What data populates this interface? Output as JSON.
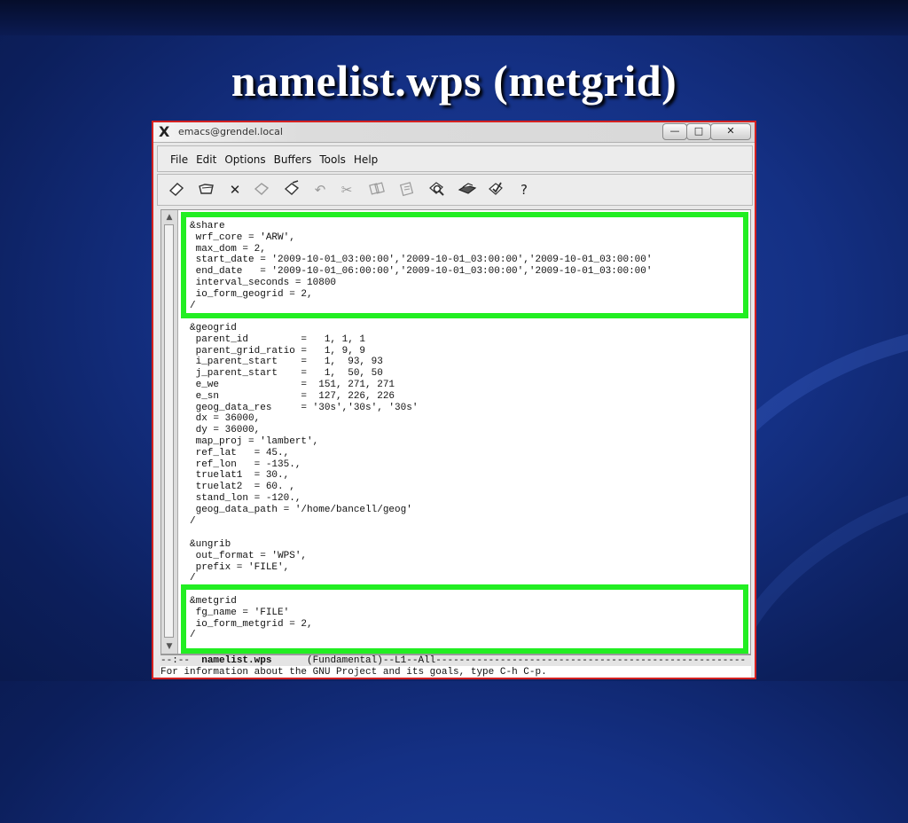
{
  "slide": {
    "title": "namelist.wps (metgrid)"
  },
  "window": {
    "title": "emacs@grendel.local",
    "controls": {
      "minimize": "—",
      "maximize": "□",
      "close": "✕"
    }
  },
  "menu": [
    "File",
    "Edit",
    "Options",
    "Buffers",
    "Tools",
    "Help"
  ],
  "toolbar_icons": [
    "new-file-icon",
    "open-folder-icon",
    "close-icon",
    "save-icon",
    "save-as-icon",
    "undo-icon",
    "cut-icon",
    "copy-icon",
    "paste-icon",
    "search-icon",
    "print-icon",
    "spell-check-icon",
    "help-icon"
  ],
  "code": {
    "share": "&share\n wrf_core = 'ARW',\n max_dom = 2,\n start_date = '2009-10-01_03:00:00','2009-10-01_03:00:00','2009-10-01_03:00:00'\n end_date   = '2009-10-01_06:00:00','2009-10-01_03:00:00','2009-10-01_03:00:00'\n interval_seconds = 10800\n io_form_geogrid = 2,\n/",
    "geogrid": "&geogrid\n parent_id         =   1, 1, 1\n parent_grid_ratio =   1, 9, 9\n i_parent_start    =   1,  93, 93\n j_parent_start    =   1,  50, 50\n e_we              =  151, 271, 271\n e_sn              =  127, 226, 226\n geog_data_res     = '30s','30s', '30s'\n dx = 36000,\n dy = 36000,\n map_proj = 'lambert',\n ref_lat   = 45.,\n ref_lon   = -135.,\n truelat1  = 30.,\n truelat2  = 60. ,\n stand_lon = -120.,\n geog_data_path = '/home/bancell/geog'\n/",
    "ungrib": "&ungrib\n out_format = 'WPS',\n prefix = 'FILE',\n/",
    "metgrid": "&metgrid\n fg_name = 'FILE'\n io_form_metgrid = 2,\n/"
  },
  "modeline": {
    "prefix": "--:--  ",
    "buffer": "namelist.wps",
    "mode": "      (Fundamental)--L1--All-----------------------------------------------------"
  },
  "minibuffer": "For information about the GNU Project and its goals, type C-h C-p.",
  "colors": {
    "highlight": "#22ee22",
    "window_border": "#d42020",
    "background": "#143084"
  }
}
